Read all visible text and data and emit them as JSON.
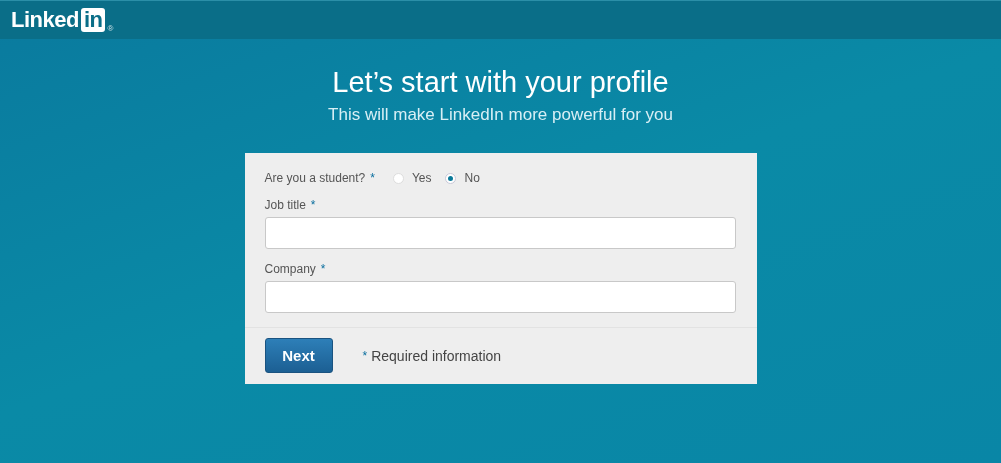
{
  "header": {
    "logo_text": "Linked",
    "logo_box_text": "in",
    "logo_mark": "®"
  },
  "heading": {
    "title": "Let’s start with your profile",
    "subtitle": "This will make LinkedIn more powerful for you"
  },
  "student_question": {
    "label": "Are you a student?",
    "required_mark": "*",
    "options": [
      {
        "label": "Yes",
        "selected": false
      },
      {
        "label": "No",
        "selected": true
      }
    ]
  },
  "fields": [
    {
      "label": "Job title",
      "required_mark": "*"
    },
    {
      "label": "Company",
      "required_mark": "*"
    }
  ],
  "footer": {
    "button": "Next",
    "note_mark": "*",
    "note": "Required information"
  }
}
